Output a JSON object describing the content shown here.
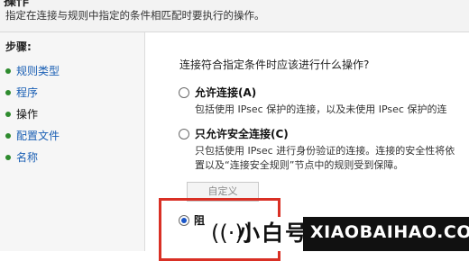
{
  "header": {
    "title": "操作",
    "description": "指定在连接与规则中指定的条件相匹配时要执行的操作。"
  },
  "steps": {
    "title": "步骤:",
    "items": [
      {
        "label": "规则类型",
        "state": "link"
      },
      {
        "label": "程序",
        "state": "link"
      },
      {
        "label": "操作",
        "state": "current"
      },
      {
        "label": "配置文件",
        "state": "link"
      },
      {
        "label": "名称",
        "state": "link"
      }
    ]
  },
  "main": {
    "question": "连接符合指定条件时应该进行什么操作?",
    "options": [
      {
        "label": "允许连接(A)",
        "desc_lines": [
          "包括使用 IPsec 保护的连接，以及未使用 IPsec 保护的连"
        ],
        "checked": false
      },
      {
        "label": "只允许安全连接(C)",
        "desc_lines": [
          "只包括使用 IPsec 进行身份验证的连接。连接的安全性将依",
          "置以及“连接安全规则”节点中的规则受到保障。"
        ],
        "checked": false
      },
      {
        "label": "阻",
        "checked": true
      }
    ],
    "customize_button": "自定义"
  },
  "watermark": {
    "cn": "小白号",
    "en": "XIAOBAIHAO.COM"
  },
  "colors": {
    "highlight_border": "#d93025",
    "step_dot": "#2e8b2e",
    "link": "#1a5fb4",
    "radio_selected": "#1a56c8"
  }
}
